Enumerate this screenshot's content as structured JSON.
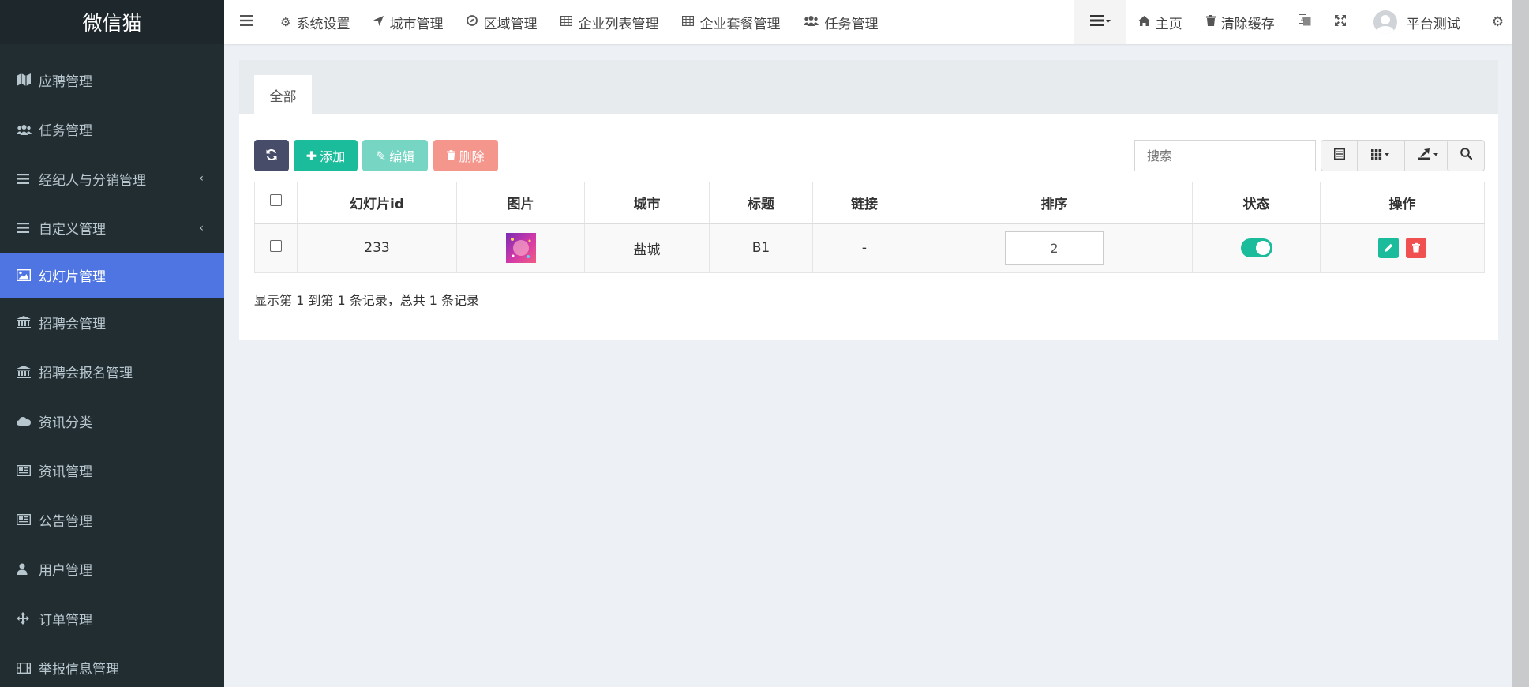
{
  "app": {
    "logo": "微信猫"
  },
  "sidebar": {
    "items": [
      {
        "label": "应聘管理",
        "icon": "map-icon",
        "active": false,
        "submenu": false
      },
      {
        "label": "任务管理",
        "icon": "users-icon",
        "active": false,
        "submenu": false
      },
      {
        "label": "经纪人与分销管理",
        "icon": "list-icon",
        "active": false,
        "submenu": true
      },
      {
        "label": "自定义管理",
        "icon": "list-icon",
        "active": false,
        "submenu": true
      },
      {
        "label": "幻灯片管理",
        "icon": "image-icon",
        "active": true,
        "submenu": false
      },
      {
        "label": "招聘会管理",
        "icon": "bank-icon",
        "active": false,
        "submenu": false
      },
      {
        "label": "招聘会报名管理",
        "icon": "bank-icon",
        "active": false,
        "submenu": false
      },
      {
        "label": "资讯分类",
        "icon": "cloud-icon",
        "active": false,
        "submenu": false
      },
      {
        "label": "资讯管理",
        "icon": "newspaper-icon",
        "active": false,
        "submenu": false
      },
      {
        "label": "公告管理",
        "icon": "newspaper-icon",
        "active": false,
        "submenu": false
      },
      {
        "label": "用户管理",
        "icon": "user-icon",
        "active": false,
        "submenu": false
      },
      {
        "label": "订单管理",
        "icon": "arrows-icon",
        "active": false,
        "submenu": false
      },
      {
        "label": "举报信息管理",
        "icon": "film-icon",
        "active": false,
        "submenu": false
      }
    ]
  },
  "topbar": {
    "nav": [
      {
        "label": "系统设置",
        "icon": "cogs-icon"
      },
      {
        "label": "城市管理",
        "icon": "location-arrow-icon"
      },
      {
        "label": "区域管理",
        "icon": "compass-icon"
      },
      {
        "label": "企业列表管理",
        "icon": "table-icon"
      },
      {
        "label": "企业套餐管理",
        "icon": "table-icon"
      },
      {
        "label": "任务管理",
        "icon": "users-icon"
      }
    ],
    "home": "主页",
    "clear_cache": "清除缓存",
    "user_name": "平台测试"
  },
  "tabs": [
    {
      "label": "全部"
    }
  ],
  "toolbar": {
    "add": "添加",
    "edit": "编辑",
    "delete": "删除",
    "search_placeholder": "搜索"
  },
  "table": {
    "columns": [
      "幻灯片id",
      "图片",
      "城市",
      "标题",
      "链接",
      "排序",
      "状态",
      "操作"
    ],
    "rows": [
      {
        "id": "233",
        "city": "盐城",
        "title": "B1",
        "link": "-",
        "sort": "2",
        "status_on": true
      }
    ]
  },
  "pager": {
    "summary": "显示第 1 到第 1 条记录，总共 1 条记录"
  },
  "colors": {
    "sidebar_bg": "#222d32",
    "active_item": "#4f75e2",
    "success": "#1bbc9b",
    "danger": "#f05050",
    "refresh": "#474d68"
  }
}
